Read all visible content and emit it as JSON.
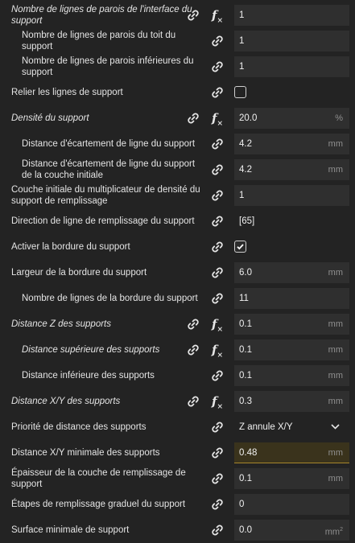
{
  "rows": [
    {
      "label": [
        "Nombre de lignes de parois de l'interface du",
        "support"
      ],
      "italic": true,
      "value": "1",
      "unit": "",
      "fx": true
    },
    {
      "label": [
        "Nombre de lignes de parois du toit du",
        "support"
      ],
      "value": "1",
      "unit": ""
    },
    {
      "label": [
        "Nombre de lignes de parois inférieures du",
        "support"
      ],
      "value": "1",
      "unit": ""
    },
    {
      "label": [
        "Relier les lignes de support"
      ],
      "checkbox": false
    },
    {
      "label": [
        "Densité du support"
      ],
      "italic": true,
      "value": "20.0",
      "unit": "%",
      "fx": true
    },
    {
      "label": [
        "Distance d'écartement de ligne du support"
      ],
      "value": "4.2",
      "unit": "mm"
    },
    {
      "label": [
        "Distance d'écartement de ligne du support",
        "de la couche initiale"
      ],
      "value": "4.2",
      "unit": "mm"
    },
    {
      "label": [
        "Couche initiale du multiplicateur de densité du",
        "support de remplissage"
      ],
      "value": "1",
      "unit": ""
    },
    {
      "label": [
        "Direction de ligne de remplissage du support"
      ],
      "plain": "[65]"
    },
    {
      "label": [
        "Activer la bordure du support"
      ],
      "checkbox": true
    },
    {
      "label": [
        "Largeur de la bordure du support"
      ],
      "value": "6.0",
      "unit": "mm"
    },
    {
      "label": [
        "Nombre de lignes de la bordure du support"
      ],
      "value": "11",
      "unit": ""
    },
    {
      "label": [
        "Distance Z des supports"
      ],
      "italic": true,
      "value": "0.1",
      "unit": "mm",
      "fx": true
    },
    {
      "label": [
        "Distance supérieure des supports"
      ],
      "italic": true,
      "value": "0.1",
      "unit": "mm",
      "fx": true
    },
    {
      "label": [
        "Distance inférieure des supports"
      ],
      "value": "0.1",
      "unit": "mm"
    },
    {
      "label": [
        "Distance X/Y des supports"
      ],
      "italic": true,
      "value": "0.3",
      "unit": "mm",
      "fx": true
    },
    {
      "label": [
        "Priorité de distance des supports"
      ],
      "select": "Z annule X/Y"
    },
    {
      "label": [
        "Distance X/Y minimale des supports"
      ],
      "value": "0.48",
      "unit": "mm",
      "highlight": true
    },
    {
      "label": [
        "Épaisseur de la couche de remplissage de",
        "support"
      ],
      "value": "0.1",
      "unit": "mm"
    },
    {
      "label": [
        "Étapes de remplissage graduel du support"
      ],
      "value": "0",
      "unit": ""
    },
    {
      "label": [
        "Surface minimale de support"
      ],
      "value": "0.0",
      "unit": "mm",
      "unit_sup": "2"
    }
  ]
}
